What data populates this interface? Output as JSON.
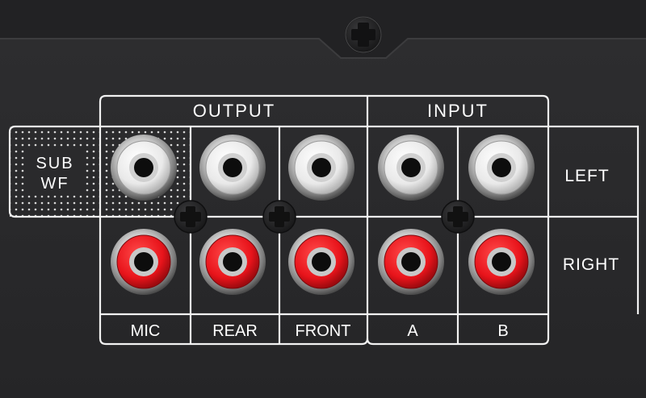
{
  "panel": {
    "output_label": "OUTPUT",
    "input_label": "INPUT",
    "sub_label_line1": "SUB",
    "sub_label_line2": "WF",
    "left_label": "LEFT",
    "right_label": "RIGHT",
    "columns": {
      "mic": "MIC",
      "rear": "REAR",
      "front": "FRONT",
      "a": "A",
      "b": "B"
    },
    "colors": {
      "panel": "#2a2a2c",
      "lines": "#f2f2f2",
      "white_jack": "#f4f4f4",
      "red_jack": "#e8141b"
    }
  }
}
